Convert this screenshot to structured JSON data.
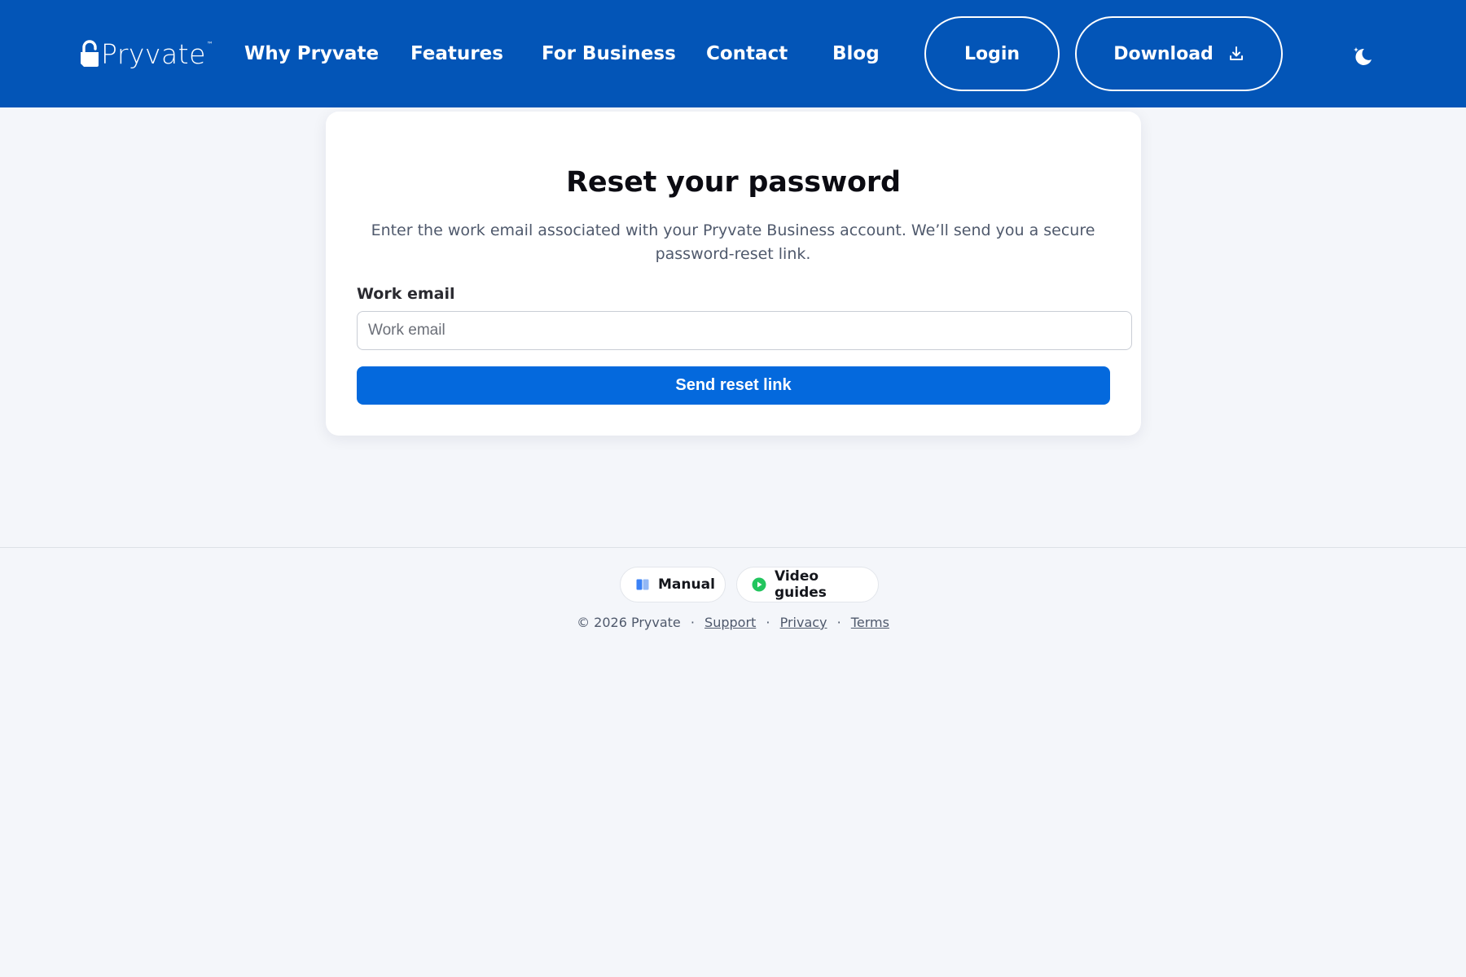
{
  "header": {
    "logo_text": "Pryvate",
    "logo_tm": "™",
    "nav": [
      "Why Pryvate",
      "Features",
      "For Business",
      "Contact",
      "Blog"
    ],
    "login_label": "Login",
    "download_label": "Download",
    "theme_icon": "moon-stars-icon"
  },
  "card": {
    "title": "Reset your password",
    "description": "Enter the work email associated with your Pryvate Business account. We’ll send you a secure password-reset link.",
    "email_label": "Work email",
    "email_placeholder": "Work email",
    "email_value": "",
    "submit_label": "Send reset link"
  },
  "footer": {
    "manual_label": "Manual",
    "video_label": "Video guides",
    "copyright": "© 2026 Pryvate",
    "separator": "·",
    "links": {
      "support": "Support",
      "privacy": "Privacy",
      "terms": "Terms"
    }
  },
  "colors": {
    "header_bg": "#0355b7",
    "primary_button": "#0469dd",
    "page_bg": "#f4f6fa",
    "video_icon": "#22c55e",
    "manual_icon": "#3b82f6"
  }
}
